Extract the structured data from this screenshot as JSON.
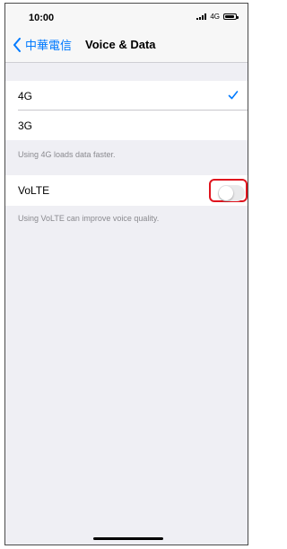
{
  "status_bar": {
    "time": "10:00",
    "network": "4G",
    "icons": [
      "signal-icon",
      "battery-icon"
    ]
  },
  "nav": {
    "back_label": "中華電信",
    "title": "Voice & Data",
    "back_icon": "chevron-left-icon"
  },
  "data_options": {
    "items": [
      {
        "label": "4G",
        "selected": true
      },
      {
        "label": "3G",
        "selected": false
      }
    ],
    "footer": "Using 4G loads data faster."
  },
  "volte": {
    "label": "VoLTE",
    "enabled": false,
    "footer": "Using VoLTE can improve voice quality."
  },
  "colors": {
    "accent": "#007aff",
    "highlight_box": "#e0141e",
    "background": "#efeff4"
  }
}
